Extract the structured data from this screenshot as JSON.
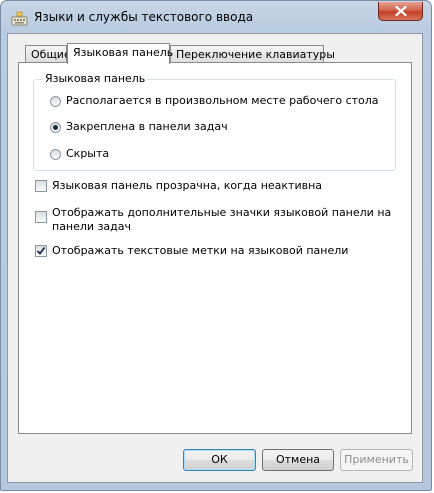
{
  "window": {
    "title": "Языки и службы текстового ввода",
    "close_icon": "close-icon"
  },
  "tabs": [
    {
      "label": "Общие",
      "active": false
    },
    {
      "label": "Языковая панель",
      "active": true
    },
    {
      "label": "Переключение клавиатуры",
      "active": false
    }
  ],
  "language_bar_group": {
    "title": "Языковая панель",
    "options": [
      {
        "label": "Располагается в произвольном месте рабочего стола",
        "selected": false
      },
      {
        "label": "Закреплена в панели задач",
        "selected": true
      },
      {
        "label": "Скрыта",
        "selected": false
      }
    ]
  },
  "checkboxes": [
    {
      "label": "Языковая панель прозрачна, когда неактивна",
      "checked": false
    },
    {
      "label_line1": "Отображать дополнительные значки языковой панели на",
      "label_line2": "панели задач",
      "checked": false
    },
    {
      "label": "Отображать текстовые метки на языковой панели",
      "checked": true
    }
  ],
  "buttons": {
    "ok": "ОК",
    "cancel": "Отмена",
    "apply": "Применить"
  }
}
